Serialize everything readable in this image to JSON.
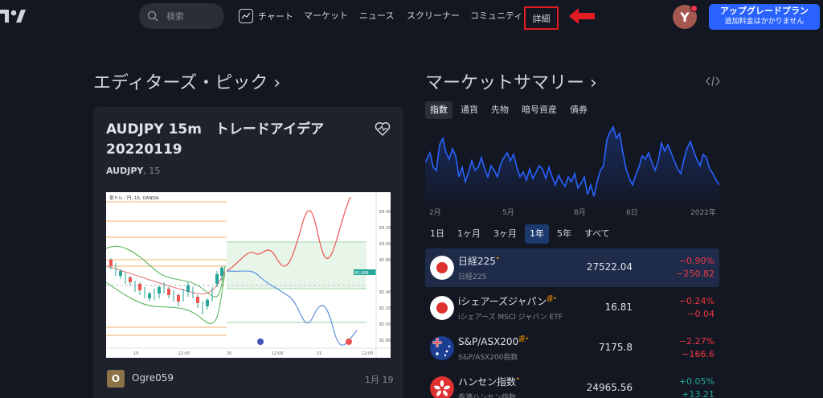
{
  "header": {
    "search_placeholder": "検索",
    "nav": {
      "chart": "チャート",
      "markets": "マーケット",
      "news": "ニュース",
      "screeners": "スクリーナー",
      "community": "コミュニティ",
      "detail": "詳細"
    },
    "avatar_letter": "Y",
    "upgrade_line1": "アップグレードプラン",
    "upgrade_line2": "追加料金はかかりません"
  },
  "editors_pick": {
    "title": "エディターズ・ピック ›",
    "idea_title": "AUDJPY 15m　トレードアイデア 20220119",
    "symbol": "AUDJPY",
    "interval": ", 15",
    "chart_caption": "豪ドル／円, 15, OANDA",
    "chart_label_1": "AUDJPY",
    "author_initial": "O",
    "author": "Ogre059",
    "date": "1月 19"
  },
  "market_summary": {
    "title": "マーケットサマリー ›",
    "tabs": [
      "指数",
      "通貨",
      "先物",
      "暗号資産",
      "債券"
    ],
    "active_tab": 0,
    "axis_labels": [
      "2月",
      "5月",
      "8月",
      "6日",
      "2022年"
    ],
    "ranges": [
      "1日",
      "1ヶ月",
      "3ヶ月",
      "1年",
      "5年",
      "すべて"
    ],
    "active_range": 3,
    "quotes": [
      {
        "name": "日経225",
        "flag_mark": "•",
        "delay": "",
        "sub": "日経225",
        "price": "27522.04",
        "chg_pct": "−0.90%",
        "chg": "−250.82",
        "dir": "neg"
      },
      {
        "name": "iシェアーズジャパン",
        "flag_mark": "•",
        "delay": "遅",
        "sub": "iシェアーズ MSCI ジャパン ETF",
        "price": "16.81",
        "chg_pct": "−0.24%",
        "chg": "−0.04",
        "dir": "neg"
      },
      {
        "name": "S&P/ASX200",
        "flag_mark": "•",
        "delay": "遅",
        "sub": "S&P/ASX200指数",
        "price": "7175.8",
        "chg_pct": "−2.27%",
        "chg": "−166.6",
        "dir": "neg"
      },
      {
        "name": "ハンセン指数",
        "flag_mark": "•",
        "delay": "",
        "sub": "香港ハンセン指数",
        "price": "24965.56",
        "chg_pct": "+0.05%",
        "chg": "+13.21",
        "dir": "pos"
      }
    ]
  },
  "colors": {
    "accent": "#2962ff",
    "negative": "#f23645",
    "positive": "#22ab94",
    "highlight_box": "#e31b23"
  }
}
